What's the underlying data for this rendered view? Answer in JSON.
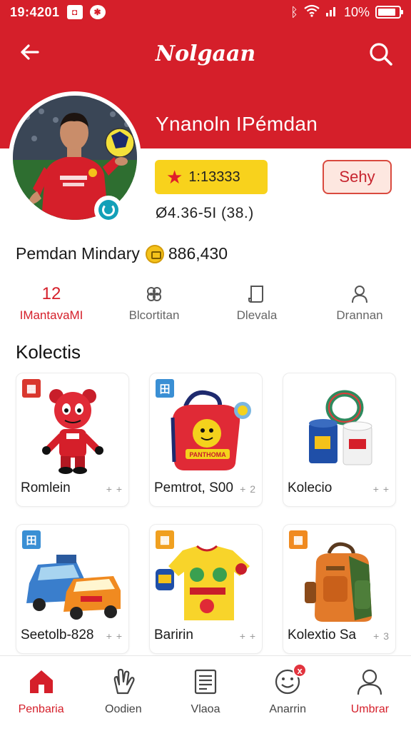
{
  "status_bar": {
    "time": "19:4201",
    "battery_text": "10%",
    "battery_level": 0.85,
    "icons": [
      "notification-icon",
      "settings-icon",
      "bluetooth-icon",
      "wifi-icon",
      "signal-icon",
      "battery-icon"
    ]
  },
  "header": {
    "title": "Nolgaan",
    "back_icon": "arrow-left-icon",
    "search_icon": "search-icon",
    "profile_name": "Ynanoln  IPémdan"
  },
  "profile": {
    "points": "1:13333",
    "share_label": "Sehy",
    "stat_line": "Ø4.36-5I (38.)",
    "member_name": "Pemdan Mindary",
    "member_value": "886,430"
  },
  "stats_tabs": [
    {
      "value": "12",
      "label": "IMantavaMI",
      "icon": "",
      "active": true
    },
    {
      "value": "",
      "label": "Blcortitan",
      "icon": "sparkle-icon",
      "active": false
    },
    {
      "value": "",
      "label": "Dlevala",
      "icon": "document-icon",
      "active": false
    },
    {
      "value": "",
      "label": "Drannan",
      "icon": "user-icon",
      "active": false
    }
  ],
  "collection": {
    "title": "Kolectis",
    "items": [
      {
        "caption": "Romlein",
        "more": "+ +",
        "tag_color": "#d9372e",
        "tag_icon": "grid-icon",
        "thumb": "mascot-figure"
      },
      {
        "caption": "Pemtrot, S00",
        "more": "+ 2",
        "tag_color": "#3a8fd4",
        "tag_icon": "grid-icon",
        "thumb": "red-backpack"
      },
      {
        "caption": "Kolecio",
        "more": "+ +",
        "tag_color": "",
        "tag_icon": "",
        "thumb": "mugs"
      },
      {
        "caption": "Seetolb-828",
        "more": "+ +",
        "tag_color": "#3a8fd4",
        "tag_icon": "grid-icon",
        "thumb": "toy-cars"
      },
      {
        "caption": "Baririn",
        "more": "+ +",
        "tag_color": "#f0a020",
        "tag_icon": "grid-icon",
        "thumb": "yellow-shirt"
      },
      {
        "caption": "Kolextio Sa",
        "more": "+ 3",
        "tag_color": "#f08a20",
        "tag_icon": "grid-icon",
        "thumb": "backpack"
      }
    ]
  },
  "bottom_nav": [
    {
      "label": "Penbaria",
      "icon": "home-icon",
      "active": true
    },
    {
      "label": "Oodien",
      "icon": "hand-icon",
      "active": false
    },
    {
      "label": "Vlaoa",
      "icon": "list-icon",
      "active": false
    },
    {
      "label": "Anarrin",
      "icon": "smile-icon",
      "active": false,
      "badge": "x"
    },
    {
      "label": "Umbrar",
      "icon": "profile-icon",
      "active": false,
      "red_label": true
    }
  ],
  "colors": {
    "brand_red": "#d51f2a",
    "points_yellow": "#f8d21c",
    "share_bg": "#fde7e0"
  }
}
